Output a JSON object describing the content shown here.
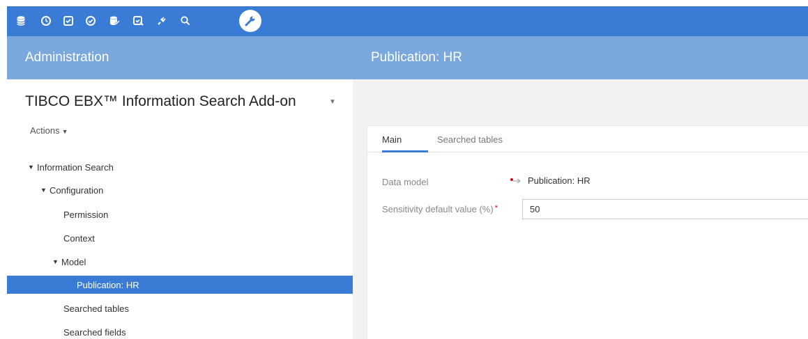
{
  "toolbar": {
    "icons": [
      "database-icon",
      "history-icon",
      "checkbox-icon",
      "validation-icon",
      "data-icon",
      "workflow-icon",
      "plugin-icon",
      "search-icon",
      "wrench-icon"
    ],
    "active_icon": "wrench-icon",
    "color": "#3a7bd5"
  },
  "header": {
    "left_title": "Administration",
    "right_title": "Publication: HR",
    "color": "#7aa7dc"
  },
  "sidebar": {
    "dataspace_title": "TIBCO EBX™ Information Search Add-on",
    "actions_label": "Actions",
    "tree": [
      {
        "label": "Information Search",
        "expanded": true,
        "level": 0
      },
      {
        "label": "Configuration",
        "expanded": true,
        "level": 1
      },
      {
        "label": "Permission",
        "level": 2
      },
      {
        "label": "Context",
        "level": 2
      },
      {
        "label": "Model",
        "expanded": true,
        "level": 2
      },
      {
        "label": "Publication: HR",
        "level": 3,
        "selected": true
      },
      {
        "label": "Searched tables",
        "level": 2
      },
      {
        "label": "Searched fields",
        "level": 2
      }
    ]
  },
  "main": {
    "tabs": [
      {
        "label": "Main",
        "active": true
      },
      {
        "label": "Searched tables",
        "active": false
      }
    ],
    "fields": {
      "data_model_label": "Data model",
      "data_model_value": "Publication: HR",
      "sensitivity_label": "Sensitivity default value (%)",
      "sensitivity_required_marker": "*",
      "sensitivity_value": "50"
    }
  },
  "colors": {
    "accent": "#3a7bd5",
    "required": "#d0021b"
  }
}
